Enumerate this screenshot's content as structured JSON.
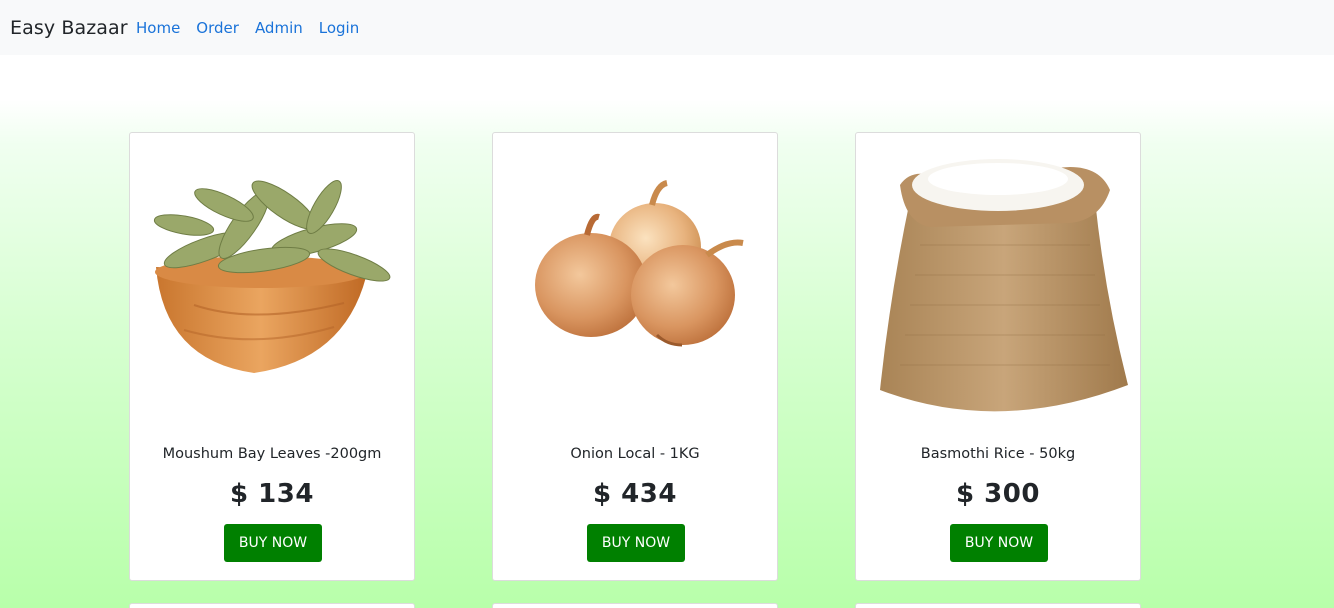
{
  "navbar": {
    "brand": "Easy Bazaar",
    "links": [
      "Home",
      "Order",
      "Admin",
      "Login"
    ]
  },
  "products": [
    {
      "title": "Moushum Bay Leaves -200gm",
      "price": "$ 134",
      "button": "BUY NOW",
      "image": "bay-leaves-bowl"
    },
    {
      "title": "Onion Local - 1KG",
      "price": "$ 434",
      "button": "BUY NOW",
      "image": "onions"
    },
    {
      "title": "Basmothi Rice - 50kg",
      "price": "$ 300",
      "button": "BUY NOW",
      "image": "rice-sack"
    }
  ],
  "colors": {
    "navbar_bg": "#f8f9fa",
    "link": "#1a73d9",
    "buy_button": "#008000",
    "background_gradient_end": "#b8ffaa"
  }
}
